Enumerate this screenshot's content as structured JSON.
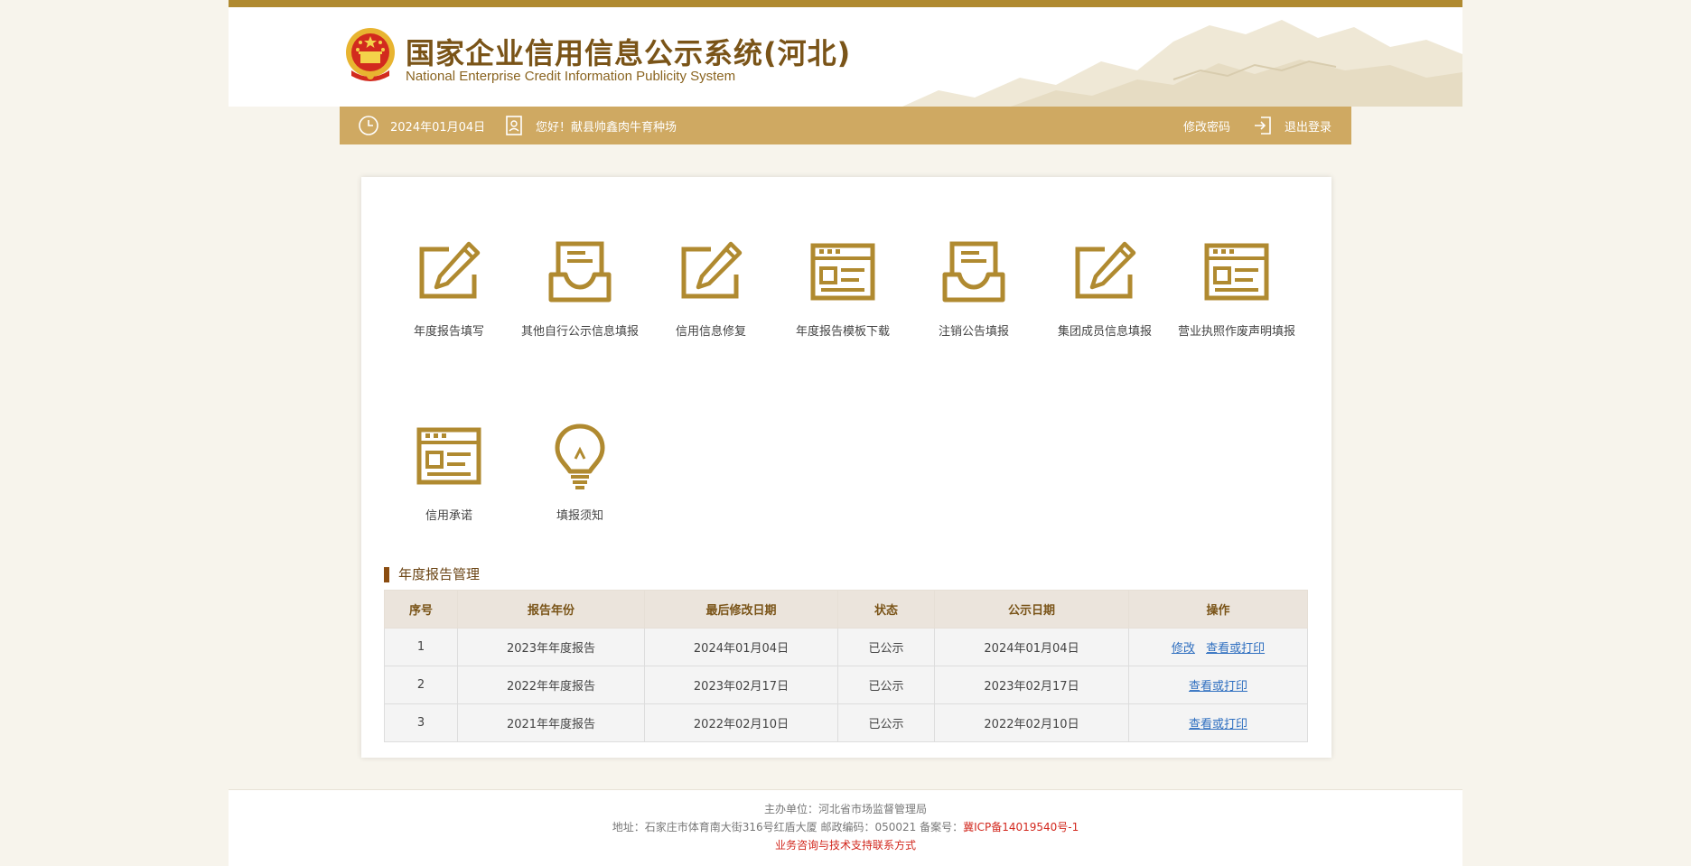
{
  "header": {
    "title": "国家企业信用信息公示系统(河北)",
    "subtitle": "National Enterprise Credit Information Publicity System"
  },
  "navbar": {
    "date": "2024年01月04日",
    "greeting": "您好！献县帅鑫肉牛育种场",
    "change_password": "修改密码",
    "logout": "退出登录"
  },
  "functions": [
    {
      "label": "年度报告填写",
      "icon": "edit-icon"
    },
    {
      "label": "其他自行公示信息填报",
      "icon": "inbox-icon"
    },
    {
      "label": "信用信息修复",
      "icon": "edit-icon"
    },
    {
      "label": "年度报告模板下载",
      "icon": "form-icon"
    },
    {
      "label": "注销公告填报",
      "icon": "inbox-icon"
    },
    {
      "label": "集团成员信息填报",
      "icon": "edit-icon"
    },
    {
      "label": "营业执照作废声明填报",
      "icon": "form-icon"
    },
    {
      "label": "信用承诺",
      "icon": "form-icon"
    },
    {
      "label": "填报须知",
      "icon": "lightbulb-icon"
    }
  ],
  "annual_reports": {
    "title": "年度报告管理",
    "columns": [
      "序号",
      "报告年份",
      "最后修改日期",
      "状态",
      "公示日期",
      "操作"
    ],
    "rows": [
      {
        "no": "1",
        "year": "2023年年度报告",
        "modified": "2024年01月04日",
        "status": "已公示",
        "published": "2024年01月04日",
        "edit": "修改",
        "view": "查看或打印"
      },
      {
        "no": "2",
        "year": "2022年年度报告",
        "modified": "2023年02月17日",
        "status": "已公示",
        "published": "2023年02月17日",
        "view": "查看或打印"
      },
      {
        "no": "3",
        "year": "2021年年度报告",
        "modified": "2022年02月10日",
        "status": "已公示",
        "published": "2022年02月10日",
        "view": "查看或打印"
      }
    ]
  },
  "footer": {
    "sponsor": "主办单位：河北省市场监督管理局",
    "address": "地址：石家庄市体育南大街316号红盾大厦 邮政编码：050021 备案号：",
    "icp": "冀ICP备14019540号-1",
    "contact": "业务咨询与技术支持联系方式"
  },
  "colors": {
    "gold": "#b08a30",
    "navbar": "#cfa962",
    "icon": "#b08a30",
    "link": "#2f6fc0",
    "footer_red": "#d2281e"
  }
}
